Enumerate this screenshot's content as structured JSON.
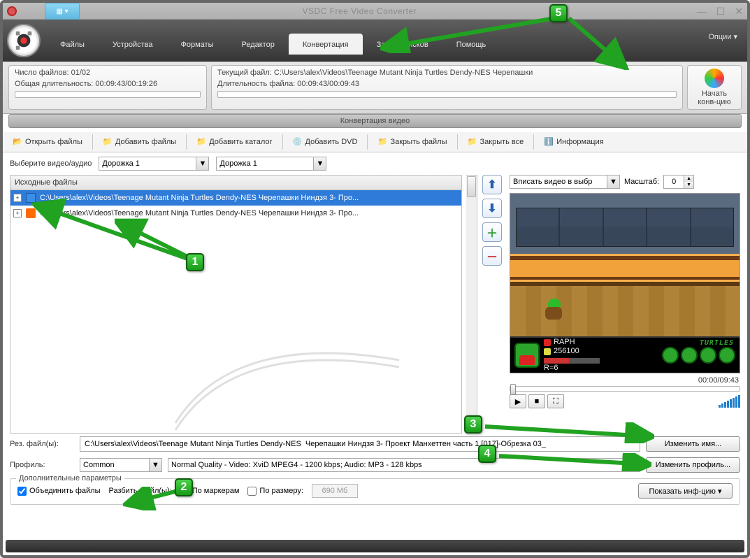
{
  "title": "VSDC Free Video Converter",
  "menu": {
    "files": "Файлы",
    "devices": "Устройства",
    "formats": "Форматы",
    "editor": "Редактор",
    "convert": "Конвертация",
    "burn": "Запись дисков",
    "help": "Помощь",
    "options": "Опции"
  },
  "status": {
    "file_count_label": "Число файлов: 01/02",
    "total_dur_label": "Общая длительность: 00:09:43/00:19:26",
    "current_file_label": "Текущий файл: C:\\Users\\alex\\Videos\\Teenage Mutant Ninja Turtles Dendy-NES  Черепашки",
    "file_dur_label": "Длительность файла: 00:09:43/00:09:43",
    "start_label": "Начать конв-цию",
    "caption": "Конвертация видео"
  },
  "toolbar": {
    "open": "Открыть файлы",
    "add": "Добавить файлы",
    "add_dir": "Добавить каталог",
    "add_dvd": "Добавить DVD",
    "close": "Закрыть файлы",
    "close_all": "Закрыть все",
    "info": "Информация"
  },
  "selects": {
    "pick_label": "Выберите видео/аудио",
    "track1": "Дорожка 1",
    "track2": "Дорожка 1",
    "fit": "Вписать видео в выбр",
    "zoom_label": "Масштаб:",
    "zoom_val": "0"
  },
  "files": {
    "header": "Исходные файлы",
    "item1": "C:\\Users\\alex\\Videos\\Teenage Mutant Ninja Turtles Dendy-NES  Черепашки Ниндзя 3- Про...",
    "item2": "C:\\Users\\alex\\Videos\\Teenage Mutant Ninja Turtles Dendy-NES  Черепашки Ниндзя 3- Про..."
  },
  "preview": {
    "time": "00:00/09:43",
    "score_name": "RAPH",
    "score_val": "256100",
    "turtles": "TURTLES",
    "rlabel": "R=6"
  },
  "output": {
    "result_label": "Рез. файл(ы):",
    "result_path": "C:\\Users\\alex\\Videos\\Teenage Mutant Ninja Turtles Dendy-NES  Черепашки Ниндзя 3- Проект Манхеттен часть 1 [017]-Обрезка 03_",
    "rename": "Изменить имя...",
    "profile_label": "Профиль:",
    "profile_group": "Common",
    "profile_desc": "Normal Quality - Video: XviD MPEG4 - 1200 kbps; Audio: MP3 - 128 kbps",
    "change_profile": "Изменить профиль..."
  },
  "extra": {
    "legend": "Дополнительные параметры",
    "merge": "Объединить файлы",
    "split": "Разбить файл(ы):",
    "by_markers": "По маркерам",
    "by_size": "По размеру:",
    "size_ph": "690 Мб",
    "show_info": "Показать инф-цию"
  },
  "markers": {
    "m1": "1",
    "m2": "2",
    "m3": "3",
    "m4": "4",
    "m5": "5"
  }
}
